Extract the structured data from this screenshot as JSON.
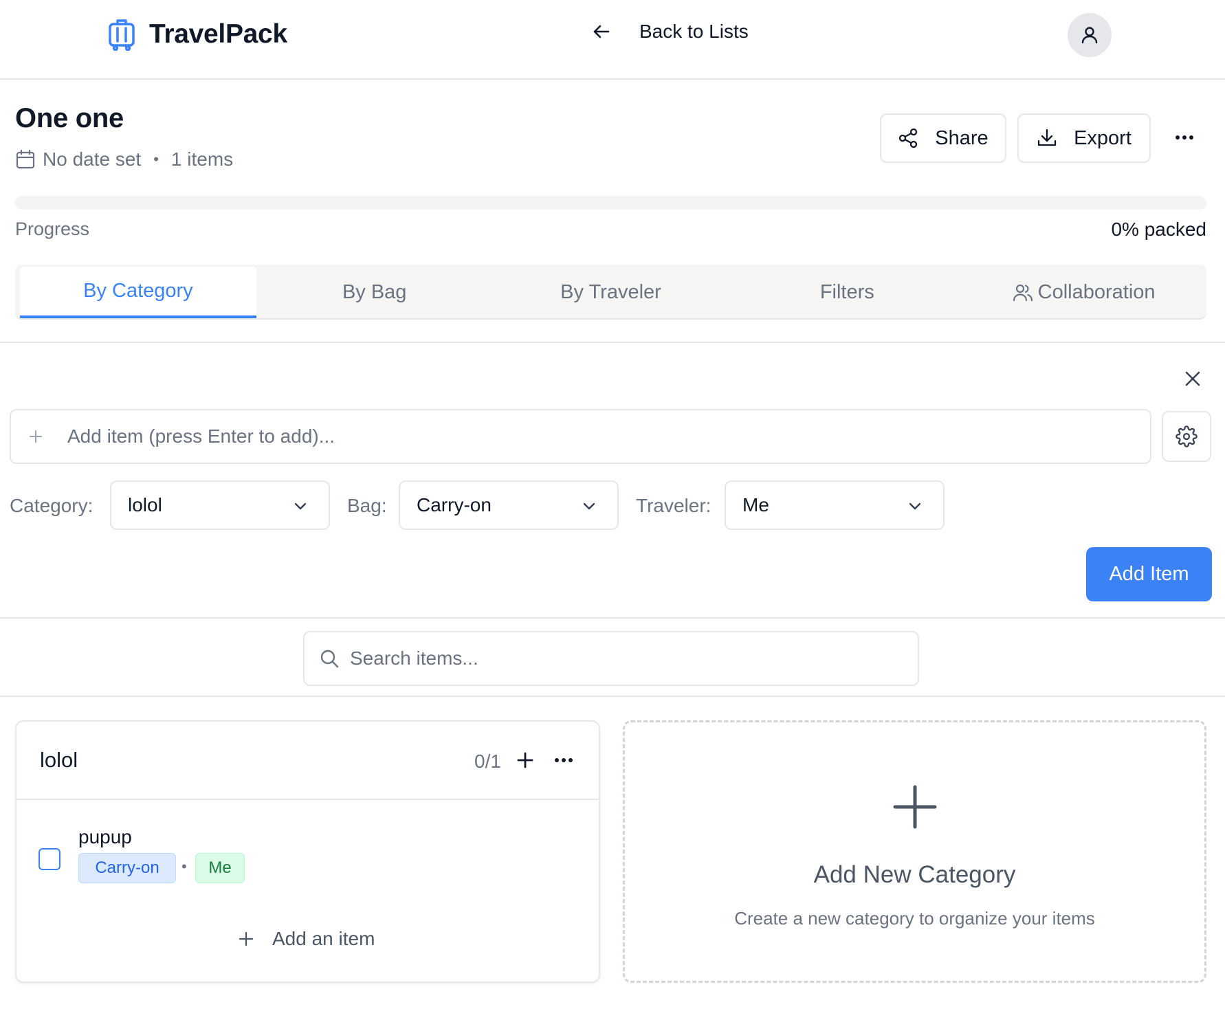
{
  "header": {
    "app_name": "TravelPack",
    "back_label": "Back to Lists",
    "icons": {
      "logo": "luggage-icon",
      "back": "arrow-left-icon",
      "user": "user-icon"
    }
  },
  "list": {
    "title": "One one",
    "date_text": "No date set",
    "separator": "•",
    "item_count_text": "1 items",
    "actions": {
      "share_label": "Share",
      "export_label": "Export"
    }
  },
  "progress": {
    "label": "Progress",
    "value_text": "0% packed",
    "percent": 0
  },
  "tabs": [
    {
      "label": "By Category",
      "active": true
    },
    {
      "label": "By Bag",
      "active": false
    },
    {
      "label": "By Traveler",
      "active": false
    },
    {
      "label": "Filters",
      "active": false
    },
    {
      "label": "Collaboration",
      "active": false,
      "icon": "users-icon"
    }
  ],
  "add_panel": {
    "input_placeholder": "Add item (press Enter to add)...",
    "input_value": "",
    "category_label": "Category:",
    "category_value": "lolol",
    "bag_label": "Bag:",
    "bag_value": "Carry-on",
    "traveler_label": "Traveler:",
    "traveler_value": "Me",
    "submit_label": "Add Item"
  },
  "search": {
    "placeholder": "Search items...",
    "value": ""
  },
  "categories": [
    {
      "name": "lolol",
      "count_text": "0/1",
      "items": [
        {
          "name": "pupup",
          "bag": "Carry-on",
          "separator": "•",
          "traveler": "Me",
          "checked": false
        }
      ],
      "add_item_label": "Add an item"
    }
  ],
  "new_category": {
    "title": "Add New Category",
    "description": "Create a new category to organize your items"
  },
  "colors": {
    "accent": "#3b82f6",
    "border": "#e5e7eb",
    "tab_bg": "#f5f5f4",
    "bag_tag_bg": "#dbeafe",
    "traveler_tag_bg": "#dcfce7"
  }
}
